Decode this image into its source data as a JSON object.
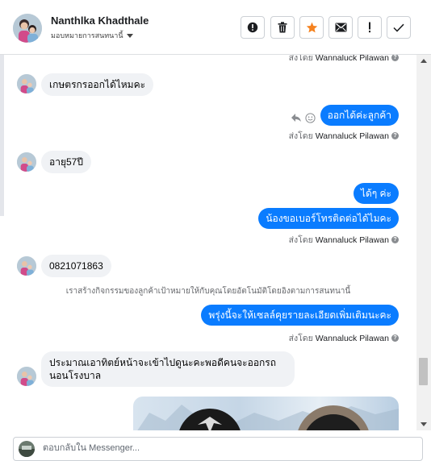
{
  "header": {
    "contact_name": "Nanthlka Khadthale",
    "assign_label": "มอบหมายการสนทนานี้",
    "tools": [
      {
        "name": "spam",
        "symbol": "!"
      },
      {
        "name": "delete",
        "symbol": ""
      },
      {
        "name": "star",
        "symbol": ""
      },
      {
        "name": "unread",
        "symbol": ""
      },
      {
        "name": "report",
        "symbol": "!"
      },
      {
        "name": "done",
        "symbol": ""
      }
    ]
  },
  "conversation": {
    "sender_prefix": "ส่งโดย",
    "sender_name": "Wannaluck Pilawan",
    "messages": [
      {
        "dir": "in",
        "text": "เกษตรกรออกได้ไหมคะ"
      },
      {
        "dir": "out",
        "text": "ออกได้ค่ะลูกค้า"
      },
      {
        "dir": "in",
        "text": "อายุ57ปี"
      },
      {
        "dir": "out",
        "text": "ได้ๆ ค่ะ"
      },
      {
        "dir": "out",
        "text": "น้องขอเบอร์โทรติดต่อได้ไมคะ"
      },
      {
        "dir": "in",
        "text": "0821071863"
      },
      {
        "dir": "out",
        "text": "พรุ่งนี้จะให้เซลล์คุยรายละเอียดเพิ่มเติมนะคะ"
      },
      {
        "dir": "in",
        "text": "ประมาณเอาทิตย์หน้าจะเข้าไปดูนะคะพอดีคนจะออกรถ นอนโรงบาล"
      }
    ],
    "system_note": "เราสร้างกิจกรรมของลูกค้าเป้าหมายให้กับคุณโดยอัตโนมัติโดยอิงตามการสนทนานี้"
  },
  "composer": {
    "placeholder": "ตอบกลับใน Messenger..."
  },
  "colors": {
    "outgoing_bubble": "#0a7cff",
    "incoming_bubble": "#f0f2f5",
    "star": "#f5821f"
  }
}
